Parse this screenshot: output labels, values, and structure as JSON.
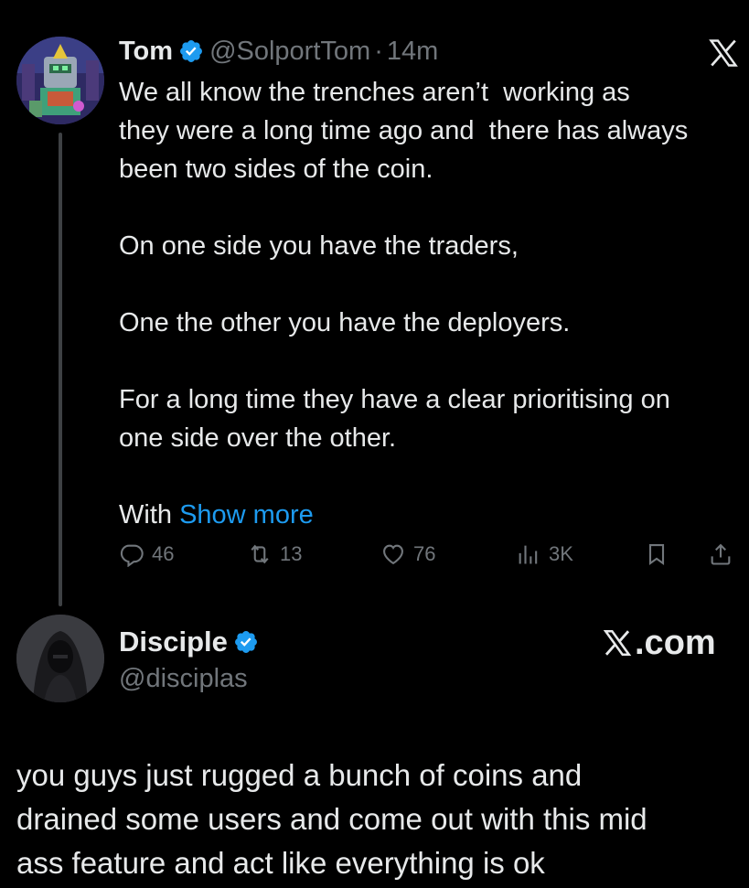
{
  "tweet": {
    "author_name": "Tom",
    "handle": "@SolportTom",
    "separator": "·",
    "time": "14m",
    "lines": [
      "We all know the trenches aren’t  working as",
      "they were a long time ago and  there has always",
      "been two sides of the coin.",
      "",
      "On one side you have the traders,",
      "",
      "One the other you have the deployers.",
      "",
      "For a long time they have a clear prioritising on",
      "one side over the other.",
      ""
    ],
    "last_line_prefix": "With ",
    "show_more": "Show more",
    "replies": "46",
    "reposts": "13",
    "likes": "76",
    "views": "3K"
  },
  "reply": {
    "author_name": "Disciple",
    "handle": "@disciplas",
    "lines": [
      "you guys just rugged a bunch of coins and",
      "drained some users and come out with this mid",
      "ass feature and act like everything is ok"
    ]
  },
  "watermark": {
    "text": ".com"
  },
  "colors": {
    "background": "#000000",
    "text": "#e7e9ea",
    "muted": "#71767b",
    "accent": "#1d9bf0"
  }
}
